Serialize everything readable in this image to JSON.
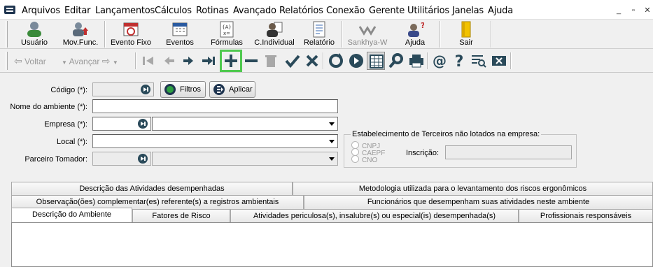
{
  "menu": [
    "Arquivos",
    "Editar",
    "Lançamentos",
    "Cálculos",
    "Rotinas",
    "Avançado",
    "Relatórios",
    "Conexão",
    "Gerente",
    "Utilitários",
    "Janelas",
    "Ajuda"
  ],
  "window_controls": {
    "minimize": "_",
    "restore": "▫",
    "close": "✕"
  },
  "big_toolbar": {
    "usuario": "Usuário",
    "movfunc": "Mov.Func.",
    "evento_fixo": "Evento Fixo",
    "eventos": "Eventos",
    "formulas": "Fórmulas",
    "cindividual": "C.Individual",
    "relatorio": "Relatório",
    "sankhya": "Sankhya-W",
    "ajuda": "Ajuda",
    "sair": "Sair"
  },
  "nav_toolbar": {
    "voltar": "Voltar",
    "avancar": "Avançar"
  },
  "form": {
    "codigo_label": "Código (*):",
    "codigo_value": "",
    "filtros_button": "Filtros",
    "aplicar_button": "Aplicar",
    "nome_label": "Nome do ambiente (*):",
    "nome_value": "",
    "empresa_label": "Empresa (*):",
    "empresa_value": "",
    "local_label": "Local (*):",
    "local_value": "",
    "parceiro_label": "Parceiro Tomador:",
    "parceiro_value": "",
    "terceiros_group_title": "Estabelecimento de Terceiros não lotados na empresa:",
    "radio_cnpj": "CNPJ",
    "radio_caepf": "CAEPF",
    "radio_cno": "CNO",
    "inscricao_label": "Inscrição:",
    "inscricao_value": ""
  },
  "tabs": {
    "row1": [
      "Descrição das Atividades desempenhadas",
      "Metodologia utilizada para o levantamento dos riscos ergonômicos"
    ],
    "row2": [
      "Observação(ões) complementar(es) referente(s) a registros ambientais",
      "Funcionários que desempenham suas atividades neste ambiente"
    ],
    "row3": [
      "Descrição do Ambiente",
      "Fatores de Risco",
      "Atividades periculosa(s), insalubre(s) ou especial(is) desempenhada(s)",
      "Profissionais responsáveis"
    ]
  },
  "colors": {
    "highlight": "#4fc94f",
    "icon_dark": "#1f3550"
  }
}
